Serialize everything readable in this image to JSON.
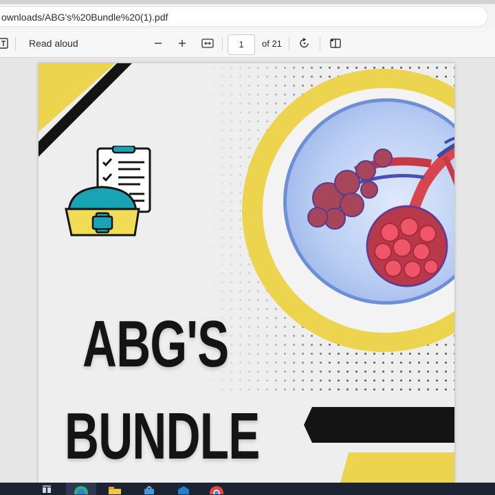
{
  "browser": {
    "url": "ownloads/ABG's%20Bundle%20(1).pdf"
  },
  "pdf_toolbar": {
    "read_aloud_label": "Read aloud",
    "current_page": "1",
    "page_count_label": "of 21"
  },
  "document": {
    "title_line1": "ABG'S",
    "title_line2": "BUNDLE"
  },
  "taskbar": {
    "icons": [
      "task-view-icon",
      "edge-icon",
      "file-explorer-icon",
      "store-icon",
      "mail-icon",
      "chrome-icon"
    ]
  },
  "colors": {
    "accent_yellow": "#ecd44f",
    "dark": "#141414",
    "teal": "#1aa3b5",
    "taskbar": "#1c2333"
  }
}
